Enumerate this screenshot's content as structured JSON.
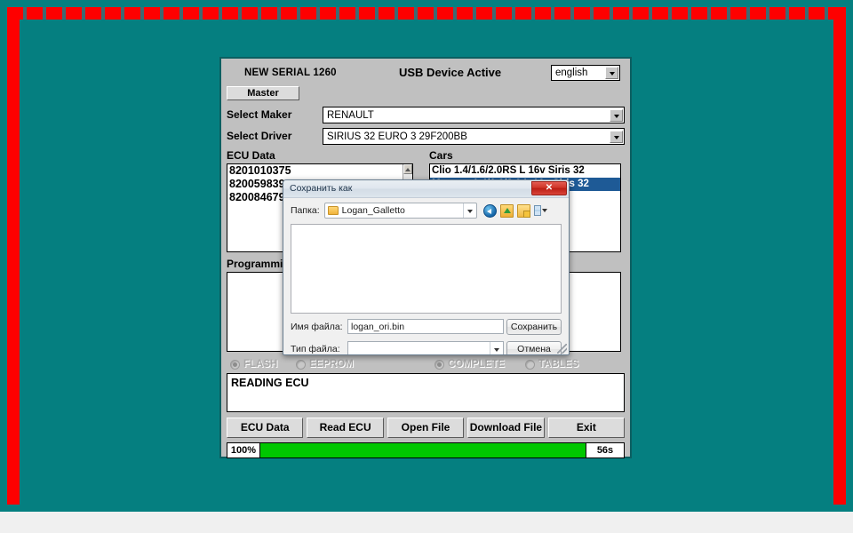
{
  "desktop": {
    "background_color": "#057f80",
    "border_color": "#fe0000"
  },
  "app": {
    "serial_label": "NEW SERIAL 1260",
    "usb_status": "USB Device Active",
    "language": {
      "value": "english",
      "icon": "chevron-down-icon"
    },
    "master_button": "Master",
    "fields": [
      {
        "label": "Select Maker",
        "value": "RENAULT"
      },
      {
        "label": "Select Driver",
        "value": "SIRIUS 32 EURO 3 29F200BB"
      }
    ],
    "ecu_data": {
      "label": "ECU Data",
      "items": [
        "8201010375",
        "8200598390",
        "8200846790"
      ]
    },
    "cars": {
      "label": "Cars",
      "items": [
        {
          "text": "Clio 1.4/1.6/2.0RS L 16v Siris 32",
          "selected": false
        },
        {
          "text": "Megane 1.4/1.6/2.0 L 16v Siris 32",
          "selected": true
        }
      ]
    },
    "programming": {
      "label": "Programming"
    },
    "radios": [
      {
        "label": "FLASH",
        "checked": true
      },
      {
        "label": "EEPROM",
        "checked": false
      },
      {
        "label": "COMPLETE",
        "checked": true
      },
      {
        "label": "TABLES",
        "checked": false
      }
    ],
    "status_log": "READING ECU",
    "actions": [
      "ECU Data",
      "Read ECU",
      "Open File",
      "Download File",
      "Exit"
    ],
    "progress": {
      "percent_label": "100%",
      "percent_value": 100,
      "time_label": "56s",
      "fill_color": "#00c700"
    }
  },
  "dialog": {
    "title": "Сохранить как",
    "close_label": "✕",
    "folder": {
      "label": "Папка:",
      "value": "Logan_Galletto"
    },
    "toolbar_icons": [
      "back-icon",
      "up-folder-icon",
      "new-folder-icon",
      "views-icon"
    ],
    "filename": {
      "label": "Имя файла:",
      "value": "logan_ori.bin"
    },
    "filetype": {
      "label": "Тип файла:",
      "value": ""
    },
    "save_button": "Сохранить",
    "cancel_button": "Отмена"
  }
}
